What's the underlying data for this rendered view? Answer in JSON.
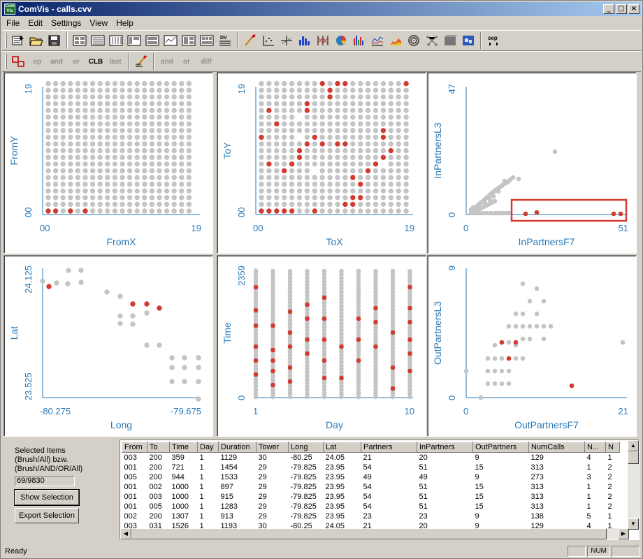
{
  "window": {
    "app": "ComVis",
    "title": "ComVis - calls.cvv",
    "icon_text": "Com Vis"
  },
  "menu": [
    "File",
    "Edit",
    "Settings",
    "View",
    "Help"
  ],
  "toolbar2": {
    "op": "op",
    "and": "and",
    "or": "or",
    "clb": "CLB",
    "last": "last",
    "and2": "and",
    "or2": "or",
    "diff": "diff"
  },
  "toolbar1": {
    "sep": "sep",
    "dv": "DV"
  },
  "plots": [
    {
      "xlabel": "FromX",
      "ylabel": "FromY",
      "xmin": "00",
      "xmax": "19",
      "ymin": "00",
      "ymax": "19"
    },
    {
      "xlabel": "ToX",
      "ylabel": "ToY",
      "xmin": "00",
      "xmax": "19",
      "ymin": "00",
      "ymax": "19"
    },
    {
      "xlabel": "InPartnersF7",
      "ylabel": "InPartnersL3",
      "xmin": "0",
      "xmax": "51",
      "ymin": "0",
      "ymax": "47"
    },
    {
      "xlabel": "Long",
      "ylabel": "Lat",
      "xmin": "-80.275",
      "xmax": "-79.675",
      "ymin": "23.525",
      "ymax": "24.125"
    },
    {
      "xlabel": "Day",
      "ylabel": "Time",
      "xmin": "1",
      "xmax": "10",
      "ymin": "0",
      "ymax": "2359"
    },
    {
      "xlabel": "OutPartnersF7",
      "ylabel": "OutPartnersL3",
      "xmin": "0",
      "xmax": "21",
      "ymin": "0",
      "ymax": "9"
    }
  ],
  "colors": {
    "unselected": "#c4c4c4",
    "selected": "#d23b30",
    "axis": "#2a7ab8",
    "brush": "#d23b30"
  },
  "selection": {
    "label1": "Selected Items",
    "label2": "(Brush/All) bzw.",
    "label3": "(Brush/AND/OR/All)",
    "count": "69/9830",
    "show_button": "Show Selection",
    "export_button": "Export Selection"
  },
  "table": {
    "columns": [
      "From",
      "To",
      "Time",
      "Day",
      "Duration",
      "Tower",
      "Long",
      "Lat",
      "Partners",
      "InPartners",
      "OutPartners",
      "NumCalls",
      "N...",
      "N"
    ],
    "rows": [
      [
        "003",
        "200",
        "359",
        "1",
        "1129",
        "30",
        "-80.25",
        "24.05",
        "21",
        "20",
        "9",
        "129",
        "4",
        "1"
      ],
      [
        "001",
        "200",
        "721",
        "1",
        "1454",
        "29",
        "-79.825",
        "23.95",
        "54",
        "51",
        "15",
        "313",
        "1",
        "2"
      ],
      [
        "005",
        "200",
        "944",
        "1",
        "1533",
        "29",
        "-79.825",
        "23.95",
        "49",
        "49",
        "9",
        "273",
        "3",
        "2"
      ],
      [
        "001",
        "002",
        "1000",
        "1",
        "897",
        "29",
        "-79.825",
        "23.95",
        "54",
        "51",
        "15",
        "313",
        "1",
        "2"
      ],
      [
        "001",
        "003",
        "1000",
        "1",
        "915",
        "29",
        "-79.825",
        "23.95",
        "54",
        "51",
        "15",
        "313",
        "1",
        "2"
      ],
      [
        "001",
        "005",
        "1000",
        "1",
        "1283",
        "29",
        "-79.825",
        "23.95",
        "54",
        "51",
        "15",
        "313",
        "1",
        "2"
      ],
      [
        "002",
        "200",
        "1307",
        "1",
        "913",
        "29",
        "-79.825",
        "23.95",
        "23",
        "23",
        "9",
        "138",
        "5",
        "1"
      ],
      [
        "003",
        "031",
        "1526",
        "1",
        "1193",
        "30",
        "-80.25",
        "24.05",
        "21",
        "20",
        "9",
        "129",
        "4",
        "1"
      ]
    ]
  },
  "status": {
    "text": "Ready",
    "num": "NUM"
  }
}
